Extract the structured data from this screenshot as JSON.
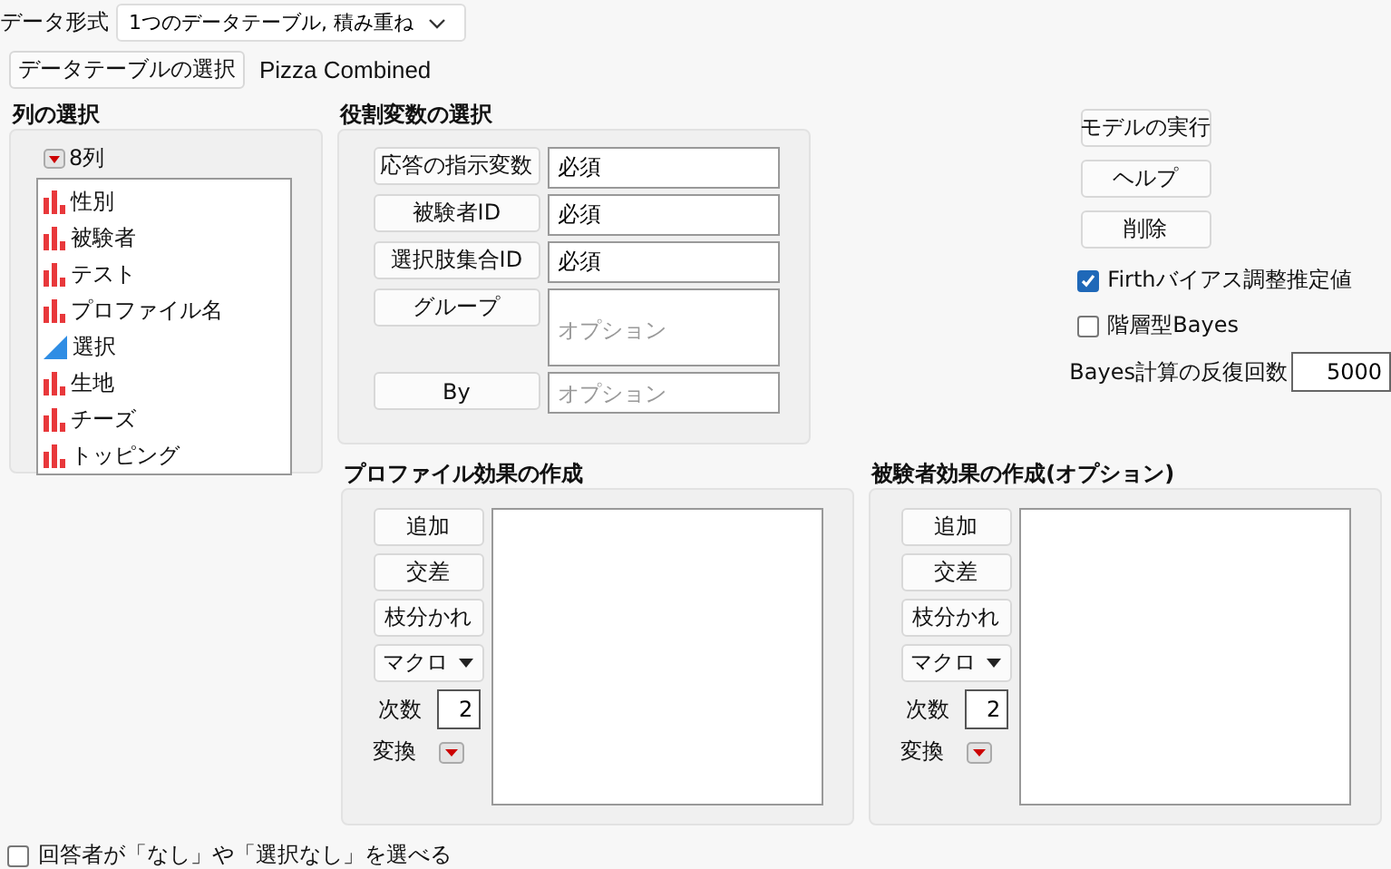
{
  "data_format": {
    "label": "データ形式",
    "value": "1つのデータテーブル, 積み重ね"
  },
  "table_select": {
    "button": "データテーブルの選択",
    "table_name": "Pizza Combined"
  },
  "column_selection": {
    "title": "列の選択",
    "count": "8列",
    "columns": [
      {
        "name": "性別",
        "kind": "nominal"
      },
      {
        "name": "被験者",
        "kind": "nominal"
      },
      {
        "name": "テスト",
        "kind": "nominal"
      },
      {
        "name": "プロファイル名",
        "kind": "nominal"
      },
      {
        "name": "選択",
        "kind": "continuous"
      },
      {
        "name": "生地",
        "kind": "nominal"
      },
      {
        "name": "チーズ",
        "kind": "nominal"
      },
      {
        "name": "トッピング",
        "kind": "nominal"
      }
    ]
  },
  "roles": {
    "title": "役割変数の選択",
    "rows": [
      {
        "button": "応答の指示変数",
        "value": "必須",
        "kind": "single"
      },
      {
        "button": "被験者ID",
        "value": "必須",
        "kind": "single"
      },
      {
        "button": "選択肢集合ID",
        "value": "必須",
        "kind": "single"
      },
      {
        "button": "グループ",
        "placeholder": "オプション",
        "kind": "multi"
      },
      {
        "button": "By",
        "placeholder": "オプション",
        "kind": "single"
      }
    ]
  },
  "actions": {
    "buttons": [
      "モデルの実行",
      "ヘルプ",
      "削除"
    ],
    "options": [
      {
        "label": "Firthバイアス調整推定値",
        "checked": true
      },
      {
        "label": "階層型Bayes",
        "checked": false
      }
    ],
    "iterations": {
      "label": "Bayes計算の反復回数",
      "value": "5000"
    }
  },
  "effects": [
    {
      "title": "プロファイル効果の作成",
      "buttons": [
        "追加",
        "交差",
        "枝分かれ"
      ],
      "macro": "マクロ",
      "degree_label": "次数",
      "degree": "2",
      "transform_label": "変換"
    },
    {
      "title": "被験者効果の作成(オプション)",
      "buttons": [
        "追加",
        "交差",
        "枝分かれ"
      ],
      "macro": "マクロ",
      "degree_label": "次数",
      "degree": "2",
      "transform_label": "変換"
    }
  ],
  "footer_option": {
    "label": "回答者が「なし」や「選択なし」を選べる",
    "checked": false
  }
}
